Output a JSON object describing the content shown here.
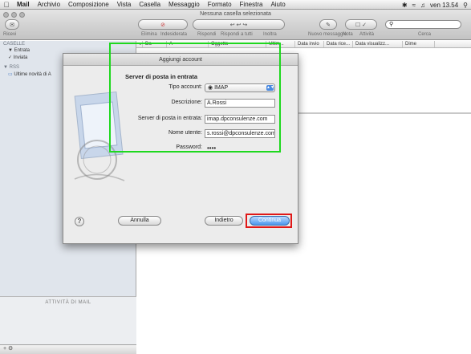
{
  "menubar": {
    "app": "Mail",
    "items": [
      "Archivio",
      "Composizione",
      "Vista",
      "Casella",
      "Messaggio",
      "Formato",
      "Finestra",
      "Aiuto"
    ],
    "clock": "ven 13.54"
  },
  "window": {
    "title": "Nessuna casella selezionata"
  },
  "toolbar": {
    "left_label": "Ricevi",
    "buttons": [
      "Elimina",
      "Indesiderata",
      "Rispondi",
      "Rispondi a tutti",
      "Inoltra",
      "Nuovo messaggio",
      "Nota",
      "Attività"
    ],
    "search_label": "Cerca"
  },
  "sidebar": {
    "mailboxes_header": "CASELLE",
    "inbox": "Entrata",
    "sent": "Inviata",
    "rss_header": "RSS",
    "rss_item": "Ultime novità di A",
    "activity": "ATTIVITÀ DI MAIL"
  },
  "list_columns": [
    "Da",
    "A",
    "Oggetto",
    "Ultim...",
    "Data invio",
    "Data rice...",
    "Data visualizz...",
    "Dime"
  ],
  "sheet": {
    "title": "Aggiungi account",
    "section": "Server di posta in entrata",
    "fields": {
      "account_type_label": "Tipo account:",
      "account_type_value": "IMAP",
      "description_label": "Descrizione:",
      "description_value": "A.Rossi",
      "server_label": "Server di posta in entrata:",
      "server_value": "imap.dpconsulenze.com",
      "username_label": "Nome utente:",
      "username_value": "s.rossi@dpconsulenze.com",
      "password_label": "Password:",
      "password_value": "••••"
    },
    "buttons": {
      "help": "?",
      "cancel": "Annulla",
      "back": "Indietro",
      "continue": "Continua"
    }
  },
  "colors": {
    "highlight_green": "#1ed81e",
    "highlight_red": "#e01818",
    "primary": "#4c97ee"
  }
}
